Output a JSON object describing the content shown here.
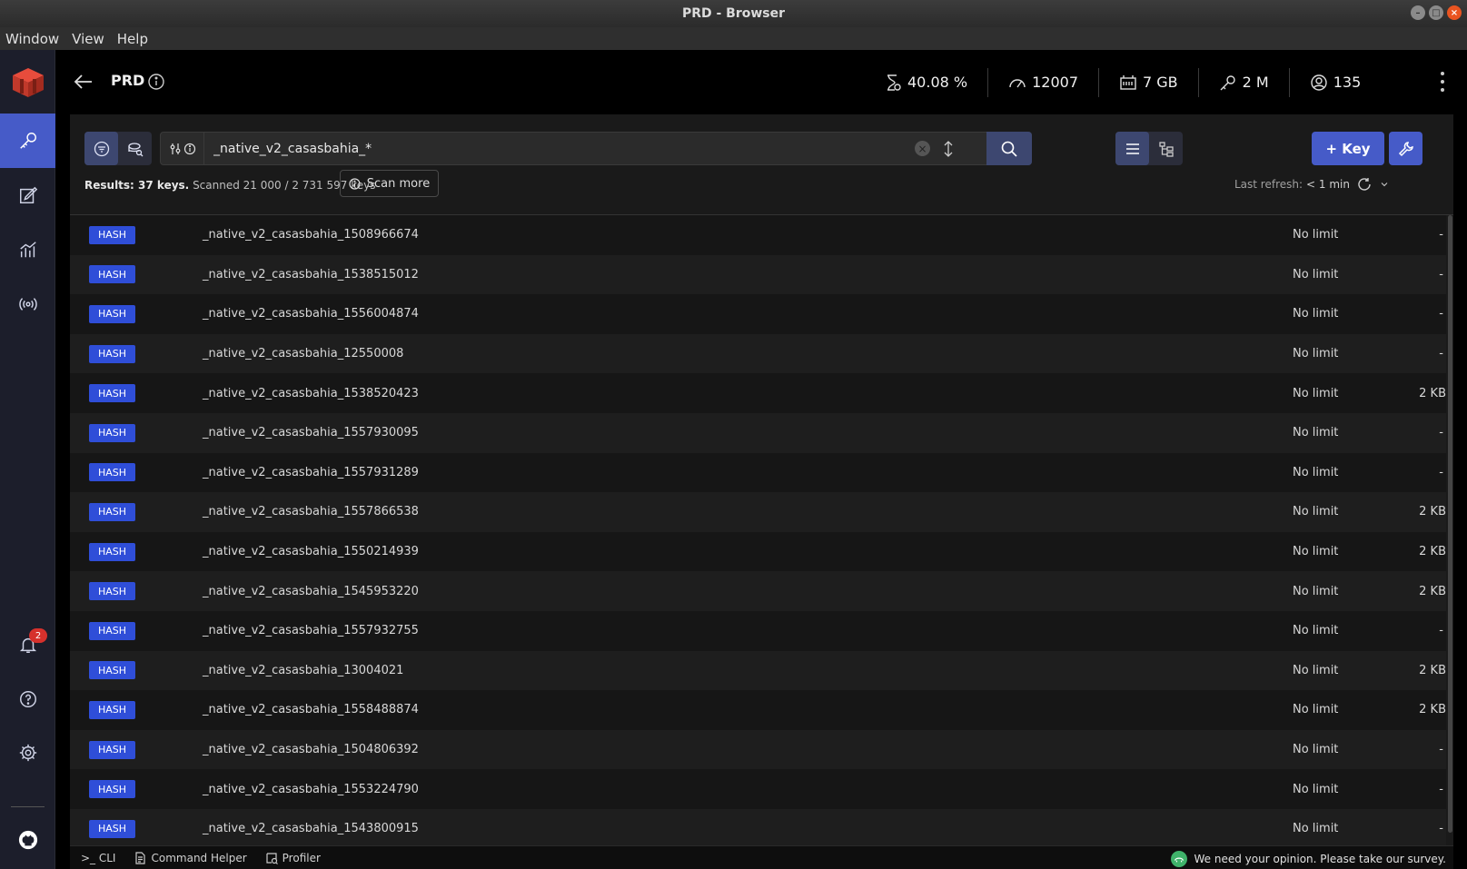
{
  "window": {
    "title": "PRD - Browser"
  },
  "menu": [
    "Window",
    "View",
    "Help"
  ],
  "header": {
    "db_name": "PRD",
    "stats": [
      {
        "icon": "cpu-hourglass-icon",
        "value": "40.08 %"
      },
      {
        "icon": "speedometer-icon",
        "value": "12007"
      },
      {
        "icon": "memory-icon",
        "value": "7 GB"
      },
      {
        "icon": "key-icon",
        "value": "2 M"
      },
      {
        "icon": "users-icon",
        "value": "135"
      }
    ]
  },
  "sidebar": {
    "items": [
      "browser",
      "workbench",
      "analytics",
      "pubsub"
    ],
    "active": "browser",
    "notifications_count": "2"
  },
  "search": {
    "value": "_native_v2_casasbahia_*"
  },
  "buttons": {
    "add_key": "+ Key",
    "scan_more": "Scan more"
  },
  "results": {
    "label": "Results: 37 keys.",
    "scanned": "Scanned 21 000 / 2 731 597 keys"
  },
  "refresh": {
    "label": "Last refresh:",
    "value": "< 1 min"
  },
  "keys": [
    {
      "type": "HASH",
      "name": "_native_v2_casasbahia_1508966674",
      "ttl": "No limit",
      "size": "-"
    },
    {
      "type": "HASH",
      "name": "_native_v2_casasbahia_1538515012",
      "ttl": "No limit",
      "size": "-"
    },
    {
      "type": "HASH",
      "name": "_native_v2_casasbahia_1556004874",
      "ttl": "No limit",
      "size": "-"
    },
    {
      "type": "HASH",
      "name": "_native_v2_casasbahia_12550008",
      "ttl": "No limit",
      "size": "-"
    },
    {
      "type": "HASH",
      "name": "_native_v2_casasbahia_1538520423",
      "ttl": "No limit",
      "size": "2 KB"
    },
    {
      "type": "HASH",
      "name": "_native_v2_casasbahia_1557930095",
      "ttl": "No limit",
      "size": "-"
    },
    {
      "type": "HASH",
      "name": "_native_v2_casasbahia_1557931289",
      "ttl": "No limit",
      "size": "-"
    },
    {
      "type": "HASH",
      "name": "_native_v2_casasbahia_1557866538",
      "ttl": "No limit",
      "size": "2 KB"
    },
    {
      "type": "HASH",
      "name": "_native_v2_casasbahia_1550214939",
      "ttl": "No limit",
      "size": "2 KB"
    },
    {
      "type": "HASH",
      "name": "_native_v2_casasbahia_1545953220",
      "ttl": "No limit",
      "size": "2 KB"
    },
    {
      "type": "HASH",
      "name": "_native_v2_casasbahia_1557932755",
      "ttl": "No limit",
      "size": "-"
    },
    {
      "type": "HASH",
      "name": "_native_v2_casasbahia_13004021",
      "ttl": "No limit",
      "size": "2 KB"
    },
    {
      "type": "HASH",
      "name": "_native_v2_casasbahia_1558488874",
      "ttl": "No limit",
      "size": "2 KB"
    },
    {
      "type": "HASH",
      "name": "_native_v2_casasbahia_1504806392",
      "ttl": "No limit",
      "size": "-"
    },
    {
      "type": "HASH",
      "name": "_native_v2_casasbahia_1553224790",
      "ttl": "No limit",
      "size": "-"
    },
    {
      "type": "HASH",
      "name": "_native_v2_casasbahia_1543800915",
      "ttl": "No limit",
      "size": "-"
    }
  ],
  "bottombar": {
    "cli": ">_ CLI",
    "command_helper": "Command Helper",
    "profiler": "Profiler",
    "survey": "We need your opinion. Please take our survey."
  },
  "colors": {
    "accent": "#465bc8",
    "hash_badge": "#2f4ed8",
    "notification": "#d6312c",
    "survey_icon": "#3fb26a"
  }
}
